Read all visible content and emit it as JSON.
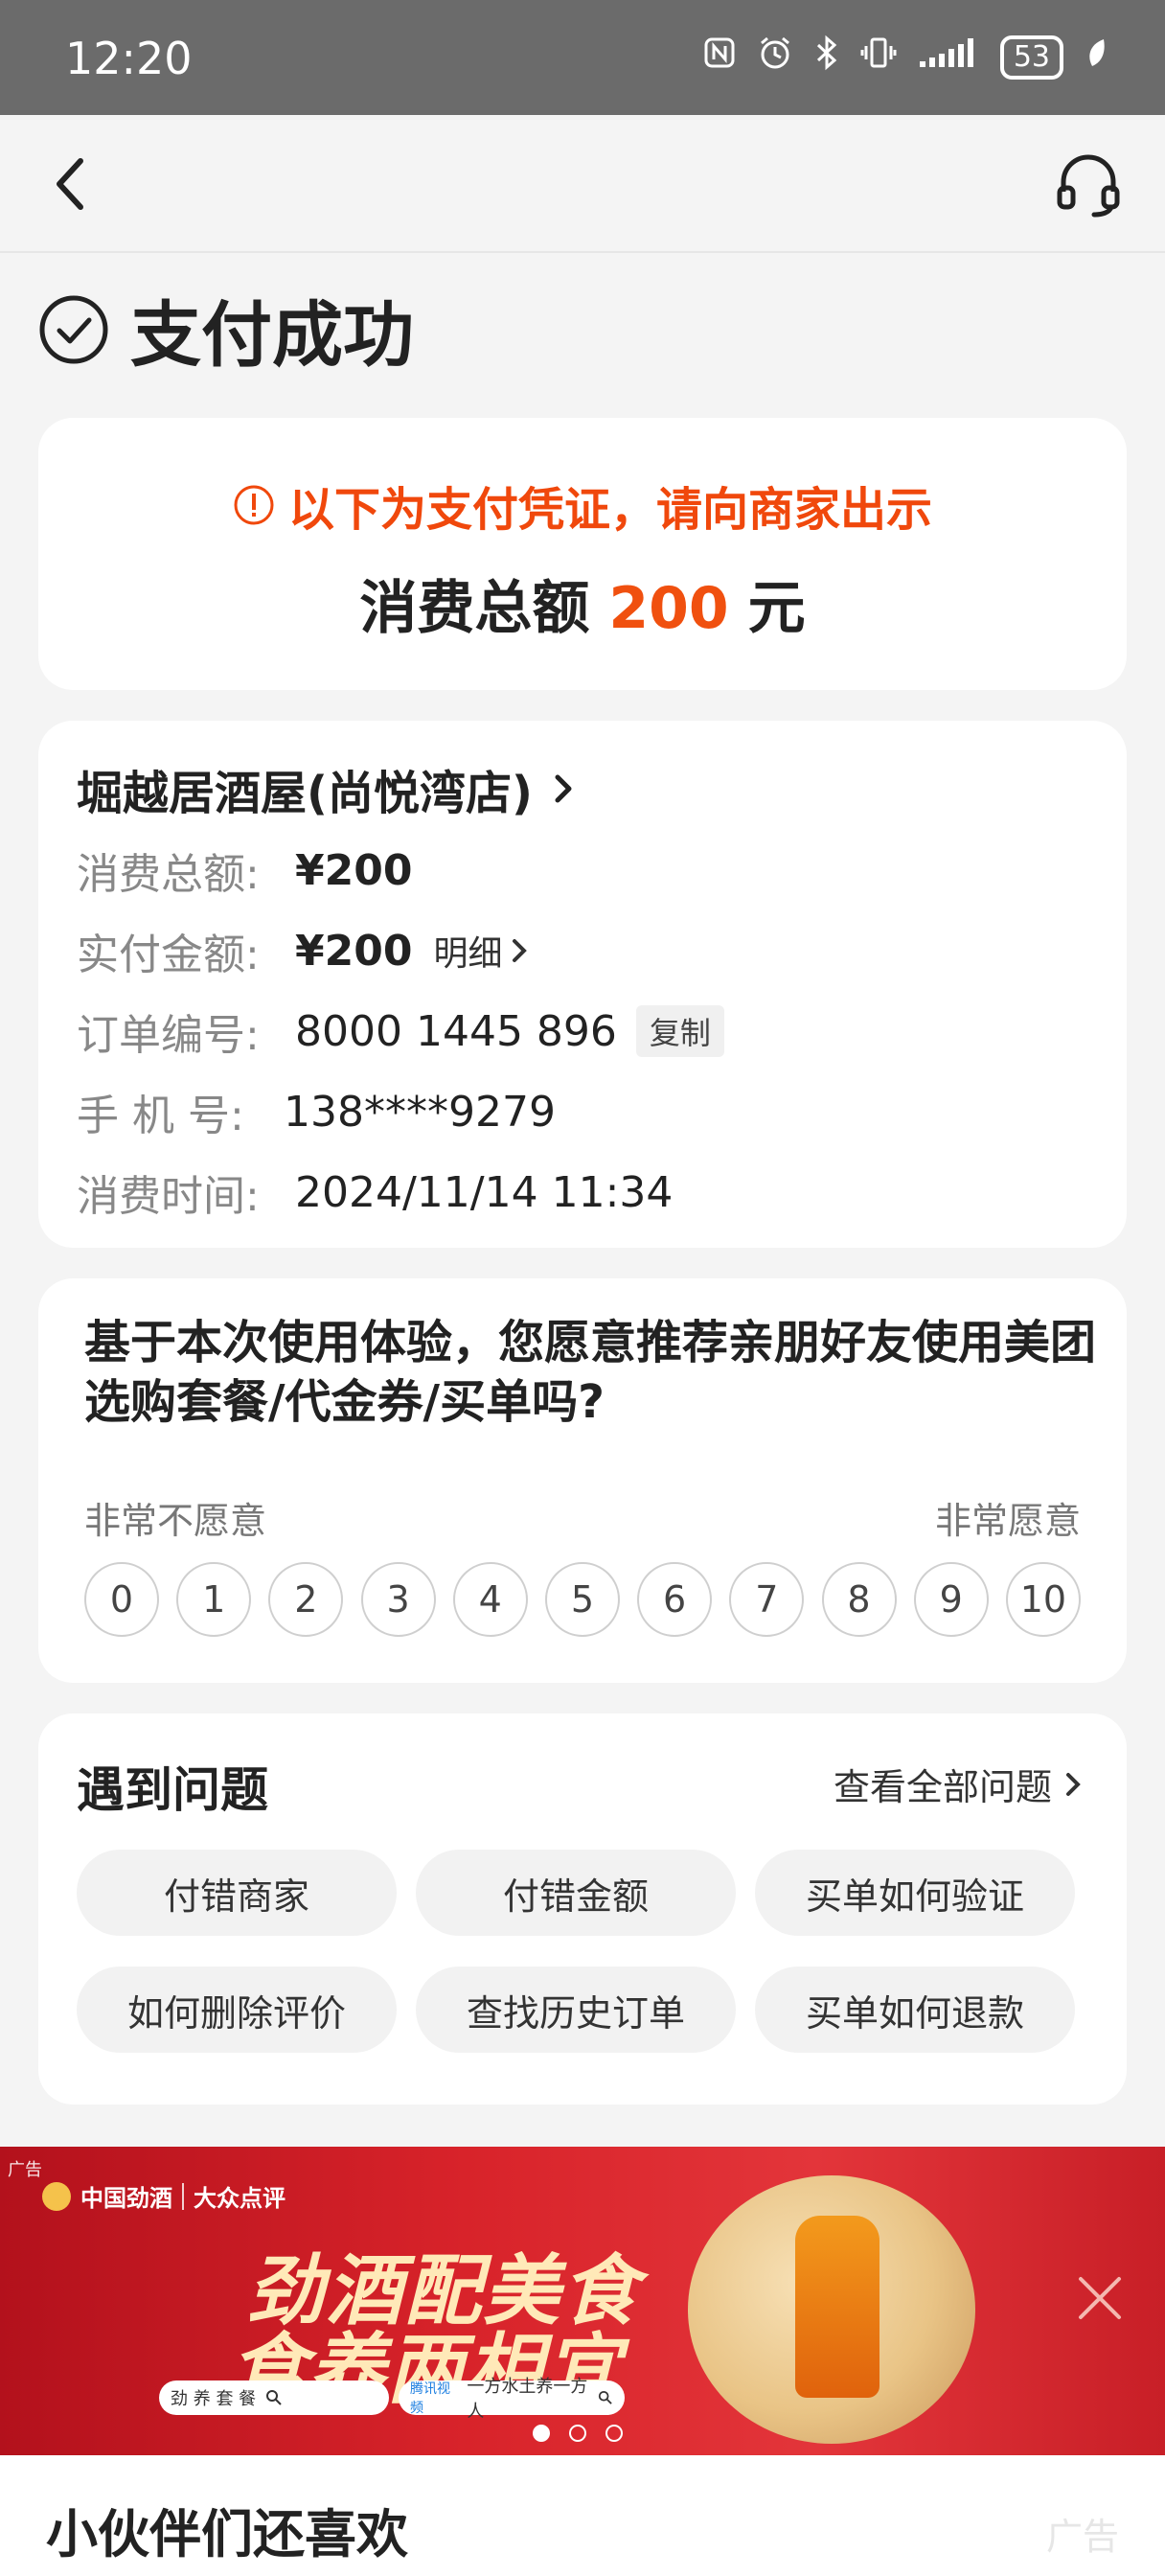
{
  "status_bar": {
    "time": "12:20",
    "battery": "53"
  },
  "nav": {
    "back_icon": "back-arrow-icon",
    "service_icon": "headset-icon"
  },
  "success": {
    "title": "支付成功"
  },
  "voucher": {
    "notice": "以下为支付凭证，请向商家出示",
    "total_label": "消费总额",
    "total_amount": "200",
    "total_unit": "元"
  },
  "order": {
    "store_name": "堀越居酒屋(尚悦湾店)",
    "rows": {
      "total": {
        "label": "消费总额:",
        "value": "¥200"
      },
      "paid": {
        "label": "实付金额:",
        "value": "¥200",
        "detail": "明细"
      },
      "order_no": {
        "label": "订单编号:",
        "value": "8000 1445 896",
        "copy": "复制"
      },
      "phone": {
        "label": "手 机 号:",
        "value": "138****9279"
      },
      "time": {
        "label": "消费时间:",
        "value": "2024/11/14 11:34"
      }
    }
  },
  "survey": {
    "question": "基于本次使用体验，您愿意推荐亲朋好友使用美团选购套餐/代金券/买单吗?",
    "low_label": "非常不愿意",
    "high_label": "非常愿意",
    "scores": [
      "0",
      "1",
      "2",
      "3",
      "4",
      "5",
      "6",
      "7",
      "8",
      "9",
      "10"
    ]
  },
  "problems": {
    "title": "遇到问题",
    "view_all": "查看全部问题",
    "chips": [
      "付错商家",
      "付错金额",
      "买单如何验证",
      "如何删除评价",
      "查找历史订单",
      "买单如何退款"
    ]
  },
  "ad": {
    "tag": "广告",
    "brand1": "中国劲酒",
    "brand2": "大众点评",
    "slogan1": "劲酒配美食",
    "slogan2": "食养两相宜",
    "search1": "劲 养 套 餐",
    "search2": "一方水土养一方人",
    "search2_prefix": "腾讯视频"
  },
  "recommend": {
    "title": "小伙伴们还喜欢",
    "ad_label": "广告"
  }
}
